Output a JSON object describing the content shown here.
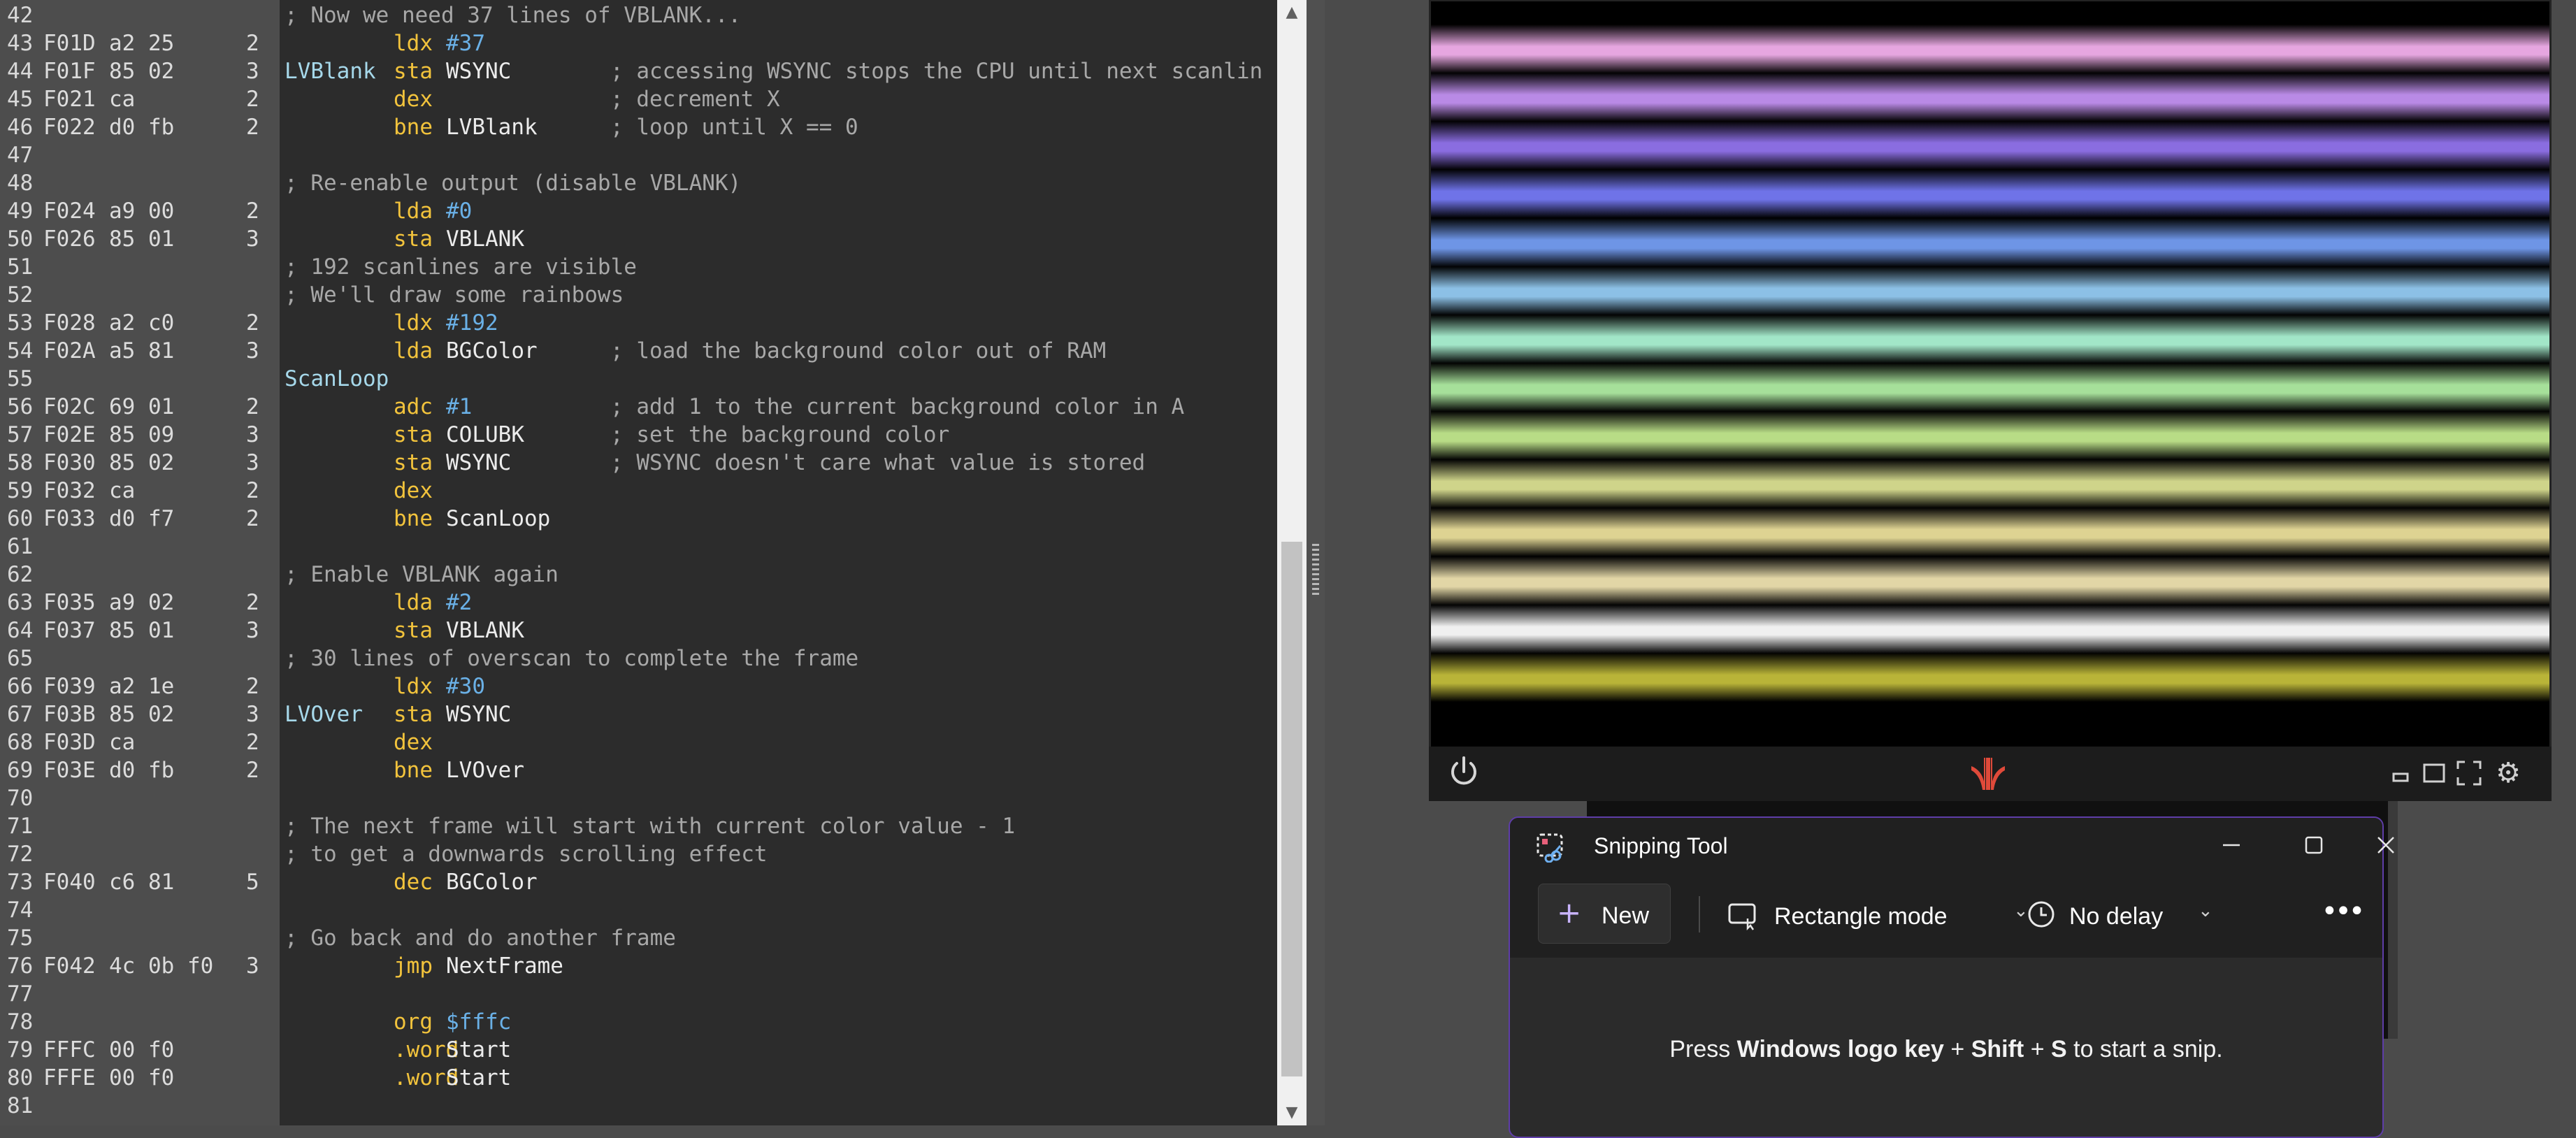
{
  "code": [
    {
      "ln": "42",
      "cmt": "; Now we need 37 lines of VBLANK..."
    },
    {
      "ln": "43",
      "addr": "F01D",
      "bytes": "a2 25",
      "cyc": "2",
      "op": "ldx",
      "arg": "#37"
    },
    {
      "ln": "44",
      "addr": "F01F",
      "bytes": "85 02",
      "cyc": "3",
      "label": "LVBlank",
      "op": "sta",
      "arg": "WSYNC",
      "cmt": "; accessing WSYNC stops the CPU until next scanlin"
    },
    {
      "ln": "45",
      "addr": "F021",
      "bytes": "ca",
      "cyc": "2",
      "op": "dex",
      "cmt": "; decrement X"
    },
    {
      "ln": "46",
      "addr": "F022",
      "bytes": "d0 fb",
      "cyc": "2",
      "op": "bne",
      "arg": "LVBlank",
      "cmt": "; loop until X == 0"
    },
    {
      "ln": "47"
    },
    {
      "ln": "48",
      "cmt": "; Re-enable output (disable VBLANK)"
    },
    {
      "ln": "49",
      "addr": "F024",
      "bytes": "a9 00",
      "cyc": "2",
      "op": "lda",
      "arg": "#0"
    },
    {
      "ln": "50",
      "addr": "F026",
      "bytes": "85 01",
      "cyc": "3",
      "op": "sta",
      "arg": "VBLANK"
    },
    {
      "ln": "51",
      "cmt": "; 192 scanlines are visible"
    },
    {
      "ln": "52",
      "cmt": "; We'll draw some rainbows"
    },
    {
      "ln": "53",
      "addr": "F028",
      "bytes": "a2 c0",
      "cyc": "2",
      "op": "ldx",
      "arg": "#192"
    },
    {
      "ln": "54",
      "addr": "F02A",
      "bytes": "a5 81",
      "cyc": "3",
      "op": "lda",
      "arg": "BGColor",
      "cmt": "; load the background color out of RAM"
    },
    {
      "ln": "55",
      "label": "ScanLoop"
    },
    {
      "ln": "56",
      "addr": "F02C",
      "bytes": "69 01",
      "cyc": "2",
      "op": "adc",
      "arg": "#1",
      "cmt": "; add 1 to the current background color in A"
    },
    {
      "ln": "57",
      "addr": "F02E",
      "bytes": "85 09",
      "cyc": "3",
      "op": "sta",
      "arg": "COLUBK",
      "cmt": "; set the background color"
    },
    {
      "ln": "58",
      "addr": "F030",
      "bytes": "85 02",
      "cyc": "3",
      "op": "sta",
      "arg": "WSYNC",
      "cmt": "; WSYNC doesn't care what value is stored"
    },
    {
      "ln": "59",
      "addr": "F032",
      "bytes": "ca",
      "cyc": "2",
      "op": "dex"
    },
    {
      "ln": "60",
      "addr": "F033",
      "bytes": "d0 f7",
      "cyc": "2",
      "op": "bne",
      "arg": "ScanLoop"
    },
    {
      "ln": "61"
    },
    {
      "ln": "62",
      "cmt": "; Enable VBLANK again"
    },
    {
      "ln": "63",
      "addr": "F035",
      "bytes": "a9 02",
      "cyc": "2",
      "op": "lda",
      "arg": "#2"
    },
    {
      "ln": "64",
      "addr": "F037",
      "bytes": "85 01",
      "cyc": "3",
      "op": "sta",
      "arg": "VBLANK"
    },
    {
      "ln": "65",
      "cmt": "; 30 lines of overscan to complete the frame"
    },
    {
      "ln": "66",
      "addr": "F039",
      "bytes": "a2 1e",
      "cyc": "2",
      "op": "ldx",
      "arg": "#30"
    },
    {
      "ln": "67",
      "addr": "F03B",
      "bytes": "85 02",
      "cyc": "3",
      "label": "LVOver",
      "op": "sta",
      "arg": "WSYNC"
    },
    {
      "ln": "68",
      "addr": "F03D",
      "bytes": "ca",
      "cyc": "2",
      "op": "dex"
    },
    {
      "ln": "69",
      "addr": "F03E",
      "bytes": "d0 fb",
      "cyc": "2",
      "op": "bne",
      "arg": "LVOver"
    },
    {
      "ln": "70"
    },
    {
      "ln": "71",
      "cmt": "; The next frame will start with current color value - 1"
    },
    {
      "ln": "72",
      "cmt": "; to get a downwards scrolling effect"
    },
    {
      "ln": "73",
      "addr": "F040",
      "bytes": "c6 81",
      "cyc": "5",
      "op": "dec",
      "arg": "BGColor"
    },
    {
      "ln": "74"
    },
    {
      "ln": "75",
      "cmt": "; Go back and do another frame"
    },
    {
      "ln": "76",
      "addr": "F042",
      "bytes": "4c 0b f0",
      "cyc": "3",
      "op": "jmp",
      "arg": "NextFrame"
    },
    {
      "ln": "77"
    },
    {
      "ln": "78",
      "op": "org",
      "arg": "$fffc"
    },
    {
      "ln": "79",
      "addr": "FFFC",
      "bytes": "00 f0",
      "op": ".word",
      "arg": "Start"
    },
    {
      "ln": "80",
      "addr": "FFFE",
      "bytes": "00 f0",
      "op": ".word",
      "arg": "Start"
    },
    {
      "ln": "81"
    }
  ],
  "colors": {
    "label": "#a6d8ea",
    "opcode": "#f2c33c",
    "number": "#6ab0e6",
    "comment": "#a8a8a8",
    "accent": "#5e3da8",
    "stripes": [
      "#e6a6e0",
      "#b98ae6",
      "#8a6de0",
      "#6f73e8",
      "#6e95e6",
      "#8cc0e6",
      "#a2e6c8",
      "#a6e09a",
      "#b8dc86",
      "#cfd48a",
      "#ded392",
      "#e2d6a6",
      "#f0f0f0",
      "#b9b438"
    ]
  },
  "emulator": {
    "icons": [
      "power-icon",
      "atari-logo",
      "minimize-screen-icon",
      "window-screen-icon",
      "fullscreen-icon",
      "gear-icon"
    ]
  },
  "snipping": {
    "title": "Snipping Tool",
    "new_label": "New",
    "mode_label": "Rectangle mode",
    "delay_label": "No delay",
    "hint_prefix": "Press ",
    "hint_key1": "Windows logo key",
    "hint_plus1": " + ",
    "hint_key2": "Shift",
    "hint_plus2": " + ",
    "hint_key3": "S",
    "hint_suffix": " to start a snip."
  }
}
